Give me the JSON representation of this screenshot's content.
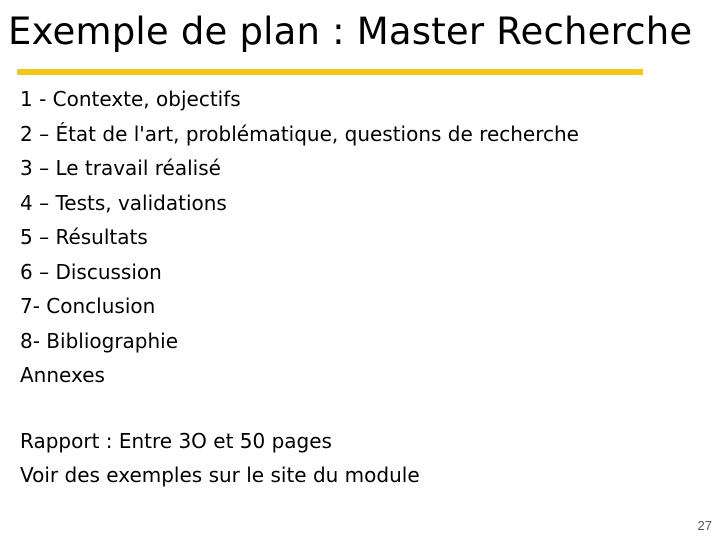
{
  "slide": {
    "title": "Exemple de plan : Master Recherche",
    "accent_color": "#f5c518",
    "outline": [
      "1 - Contexte, objectifs",
      "2 – État de l'art, problématique, questions de recherche",
      "3 – Le travail réalisé",
      "4 – Tests, validations",
      "5 – Résultats",
      "6 – Discussion",
      "7- Conclusion",
      "8- Bibliographie",
      "Annexes"
    ],
    "notes": [
      "Rapport : Entre 3O et 50 pages",
      "Voir des exemples sur le site du module"
    ],
    "page_number": "27"
  }
}
